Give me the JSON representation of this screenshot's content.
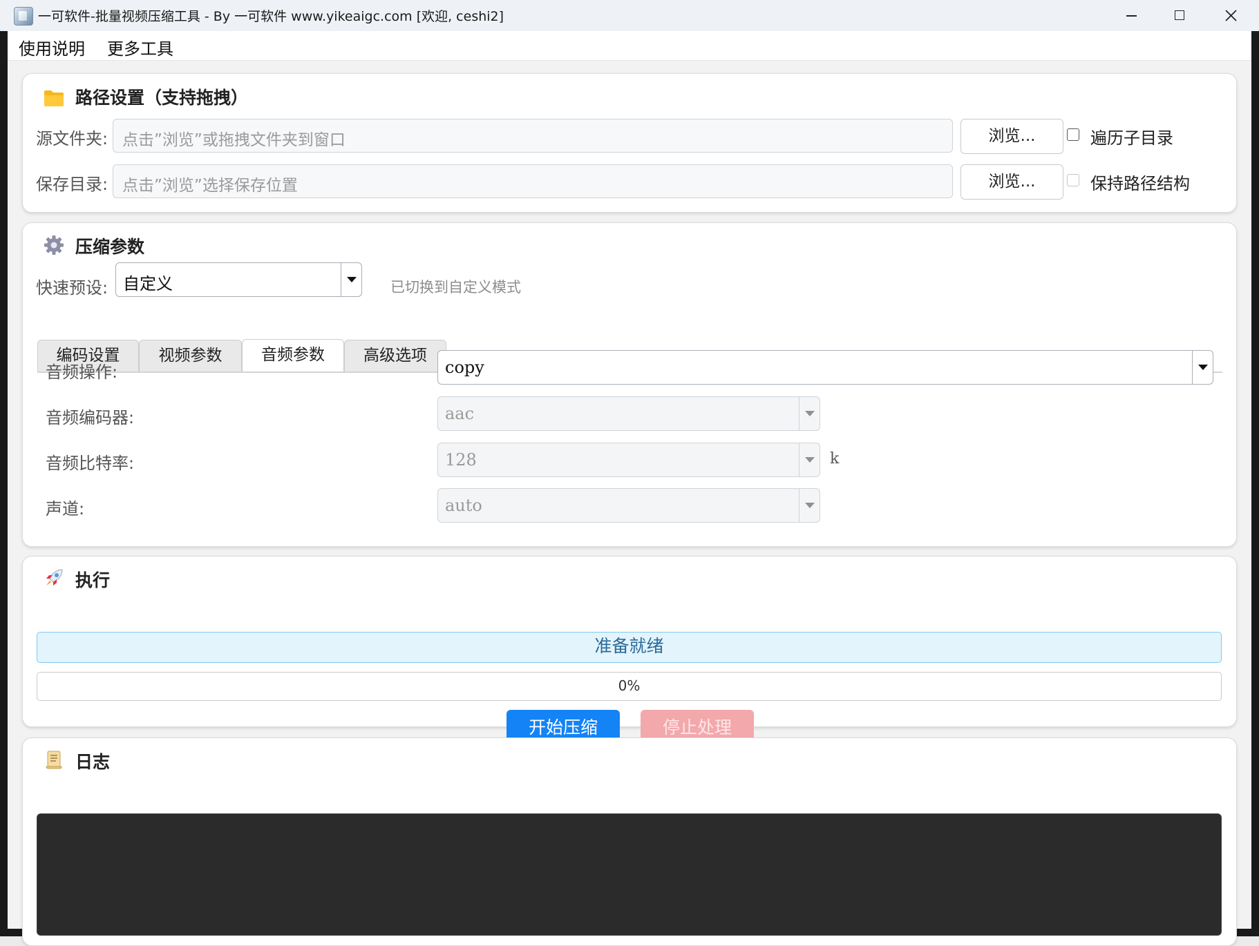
{
  "window": {
    "title": "一可软件-批量视频压缩工具 - By 一可软件 www.yikeaigc.com [欢迎, ceshi2]"
  },
  "menu": {
    "items": [
      "使用说明",
      "更多工具"
    ]
  },
  "path_section": {
    "title": "路径设置（支持拖拽）",
    "source_label": "源文件夹:",
    "source_placeholder": "点击”浏览”或拖拽文件夹到窗口",
    "save_label": "保存目录:",
    "save_placeholder": "点击”浏览”选择保存位置",
    "browse_label": "浏览...",
    "recurse_label": "遍历子目录",
    "keep_structure_label": "保持路径结构"
  },
  "compress_section": {
    "title": "压缩参数",
    "preset_label": "快速预设:",
    "preset_value": "自定义",
    "preset_hint": "已切换到自定义模式",
    "tabs": [
      "编码设置",
      "视频参数",
      "音频参数",
      "高级选项"
    ],
    "active_tab": "音频参数",
    "audio": {
      "operation_label": "音频操作:",
      "operation_value": "copy",
      "codec_label": "音频编码器:",
      "codec_value": "aac",
      "bitrate_label": "音频比特率:",
      "bitrate_value": "128",
      "bitrate_unit": "k",
      "channels_label": "声道:",
      "channels_value": "auto"
    }
  },
  "execute_section": {
    "title": "执行",
    "status_text": "准备就绪",
    "progress_percent": 0,
    "progress_text": "0%",
    "start_label": "开始压缩",
    "stop_label": "停止处理"
  },
  "log_section": {
    "title": "日志"
  },
  "colors": {
    "accent": "#1483f5",
    "stop_disabled": "#f3a8ac",
    "status_bg": "#e3f4fc",
    "status_border": "#7ec8ee",
    "log_bg": "#2b2b2b"
  }
}
